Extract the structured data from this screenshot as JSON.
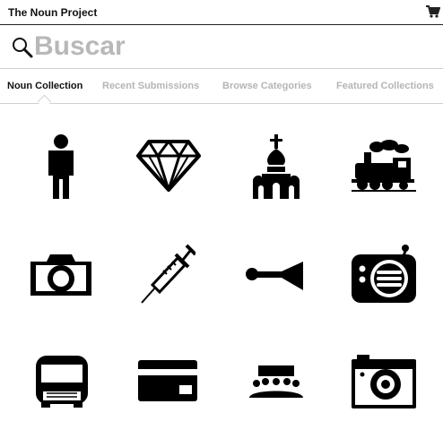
{
  "header": {
    "title": "The Noun Project",
    "cart_icon": "cart-icon"
  },
  "search": {
    "placeholder": "Buscar",
    "icon": "search-icon"
  },
  "tabs": [
    {
      "label": "Noun Collection",
      "active": true
    },
    {
      "label": "Recent Submissions",
      "active": false
    },
    {
      "label": "Browse Categories",
      "active": false
    },
    {
      "label": "Featured Collections",
      "active": false
    }
  ],
  "icons": [
    "person-icon",
    "diamond-icon",
    "church-icon",
    "train-icon",
    "camera-icon",
    "syringe-icon",
    "horn-icon",
    "radio-icon",
    "bus-icon",
    "credit-card-icon",
    "audience-icon",
    "photo-camera-icon"
  ],
  "colors": {
    "text": "#111111",
    "muted": "#b5b5b5",
    "icon": "#000000"
  }
}
